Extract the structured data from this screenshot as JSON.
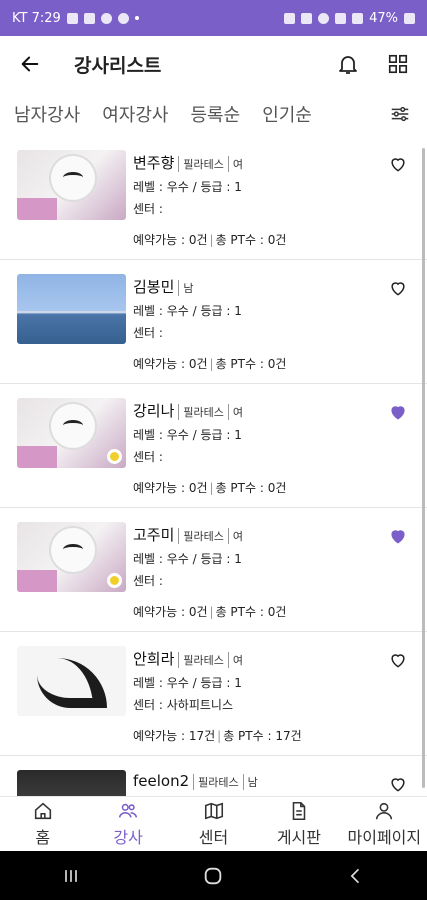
{
  "status": {
    "carrier_time": "KT 7:29",
    "battery": "47%"
  },
  "header": {
    "title": "강사리스트"
  },
  "filters": [
    "남자강사",
    "여자강사",
    "등록순",
    "인기순"
  ],
  "instructors": [
    {
      "name": "변주향",
      "type": "필라테스",
      "gender": "여",
      "level": "레벨 : 우수 / 등급 : 1",
      "center": "센터 :",
      "available": "예약가능 : 0건",
      "pt": "총 PT수 : 0건",
      "thumb": "dog",
      "badge": false,
      "liked": false
    },
    {
      "name": "김봉민",
      "type": "",
      "gender": "남",
      "level": "레벨 : 우수 / 등급 : 1",
      "center": "센터 :",
      "available": "예약가능 : 0건",
      "pt": "총 PT수 : 0건",
      "thumb": "sea",
      "badge": false,
      "liked": false
    },
    {
      "name": "강리나",
      "type": "필라테스",
      "gender": "여",
      "level": "레벨 : 우수 / 등급 : 1",
      "center": "센터 :",
      "available": "예약가능 : 0건",
      "pt": "총 PT수 : 0건",
      "thumb": "dog",
      "badge": true,
      "liked": true
    },
    {
      "name": "고주미",
      "type": "필라테스",
      "gender": "여",
      "level": "레벨 : 우수 / 등급 : 1",
      "center": "센터 :",
      "available": "예약가능 : 0건",
      "pt": "총 PT수 : 0건",
      "thumb": "dog",
      "badge": true,
      "liked": true
    },
    {
      "name": "안희라",
      "type": "필라테스",
      "gender": "여",
      "level": "레벨 : 우수 / 등급 : 1",
      "center": "센터 : 사하피트니스",
      "available": "예약가능 : 17건",
      "pt": "총 PT수 : 17건",
      "thumb": "yoga",
      "badge": false,
      "liked": false
    },
    {
      "name": "feelon2",
      "type": "필라테스",
      "gender": "남",
      "level": "",
      "center": "",
      "available": "",
      "pt": "",
      "thumb": "dark",
      "badge": false,
      "liked": false
    }
  ],
  "nav": [
    {
      "label": "홈",
      "icon": "home-icon",
      "active": false
    },
    {
      "label": "강사",
      "icon": "people-icon",
      "active": true
    },
    {
      "label": "센터",
      "icon": "map-icon",
      "active": false
    },
    {
      "label": "게시판",
      "icon": "document-icon",
      "active": false
    },
    {
      "label": "마이페이지",
      "icon": "person-icon",
      "active": false
    }
  ],
  "colors": {
    "accent": "#7b5fc9",
    "status_bar": "#7b5fc9",
    "liked": "#7b5fc9"
  }
}
